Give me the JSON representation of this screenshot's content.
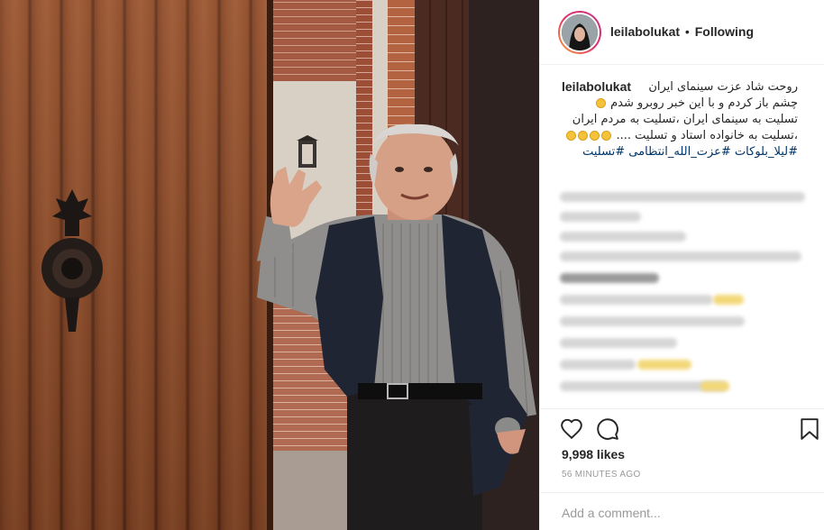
{
  "post": {
    "username": "leilabolukat",
    "separator": "•",
    "follow_status": "Following",
    "caption": {
      "username": "leilabolukat",
      "line1": "روحت شاد عزت سینمای ایران",
      "line2": "چشم باز کردم و با این خبر روبرو شدم",
      "line3": "تسلیت به سینمای ایران ،تسلیت به مردم ایران",
      "line4": "،تسلیت به خانواده استاد و تسلیت ....",
      "hashtags": "#لیلا_بلوکات #عزت_الله_انتظامی #تسلیت"
    },
    "likes": "9,998 likes",
    "time": "56 MINUTES AGO",
    "add_comment_placeholder": "Add a comment..."
  },
  "icons": {
    "like": "heart-icon",
    "comment": "comment-icon",
    "save": "bookmark-icon"
  },
  "colors": {
    "text": "#262626",
    "hashtag": "#003569",
    "muted": "#999999",
    "border": "#efefef"
  }
}
